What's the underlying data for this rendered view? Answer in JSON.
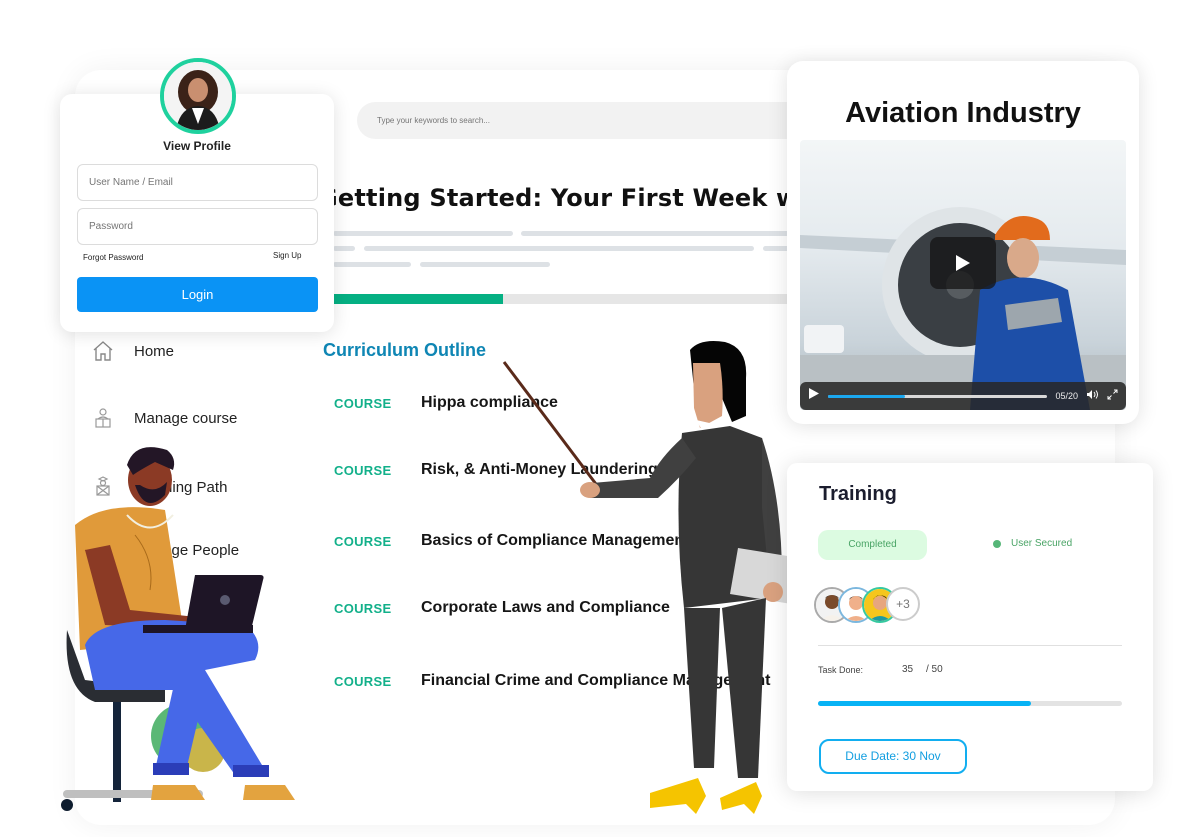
{
  "search": {
    "placeholder": "Type your keywords to search..."
  },
  "page": {
    "title": "Getting Started: Your First Week with",
    "progress_fraction": 0.37
  },
  "sidebar": {
    "items": [
      {
        "label": "Home",
        "icon": "home-icon"
      },
      {
        "label": "Manage course",
        "icon": "manage-course-icon"
      },
      {
        "label": "Learning Path",
        "icon": "learning-path-icon"
      },
      {
        "label": "Manage People",
        "icon": "people-icon"
      }
    ]
  },
  "curriculum": {
    "title": "Curriculum Outline",
    "courses": [
      {
        "tag": "COURSE",
        "name": "Hippa compliance"
      },
      {
        "tag": "COURSE",
        "name": "Risk, & Anti-Money Laundering"
      },
      {
        "tag": "COURSE",
        "name": "Basics of Compliance Management"
      },
      {
        "tag": "COURSE",
        "name": "Corporate Laws and Compliance"
      },
      {
        "tag": "COURSE",
        "name": "Financial Crime and Compliance Management"
      }
    ]
  },
  "login": {
    "view_profile": "View Profile",
    "username_placeholder": "User Name / Email",
    "password_placeholder": "Password",
    "forgot_password": "Forgot Password",
    "sign_up": "Sign Up",
    "login_button": "Login",
    "accent_color": "#1fd19e",
    "button_color": "#0a93f5"
  },
  "video": {
    "title": "Aviation Industry",
    "time": "05/20",
    "progress_fraction": 0.35
  },
  "training": {
    "title": "Training",
    "completed_badge": "Completed",
    "status": "User Secured",
    "extra_members": "+3",
    "task_label": "Task Done:",
    "task_done": "35",
    "task_total": "/ 50",
    "task_fraction": 0.7,
    "due_date": "Due Date: 30 Nov"
  }
}
